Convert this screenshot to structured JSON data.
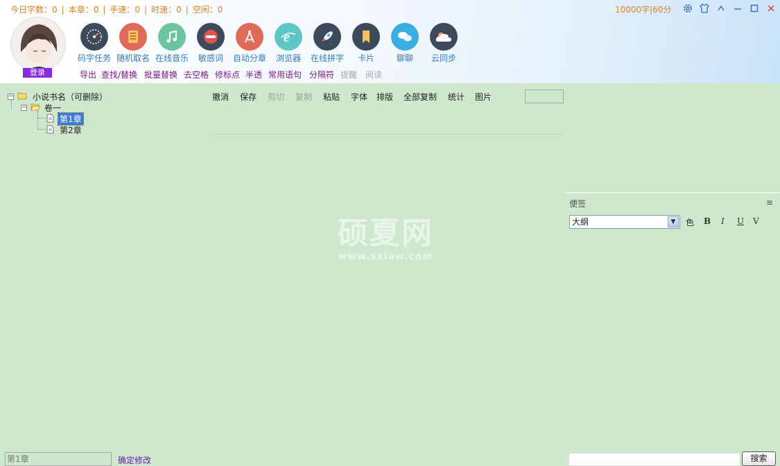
{
  "header": {
    "stats": [
      {
        "label": "今日字数：0"
      },
      {
        "label": "本章：0"
      },
      {
        "label": "手速：0"
      },
      {
        "label": "时速：0"
      },
      {
        "label": "空闲：0"
      }
    ],
    "quota": "10000字|60分",
    "login_label": "登录"
  },
  "toolbar": {
    "tools": [
      {
        "label": "码字任务",
        "icon": "speedometer-icon",
        "color": "#3d4a5c"
      },
      {
        "label": "随机取名",
        "icon": "notebook-icon",
        "color": "#e06b5a"
      },
      {
        "label": "在线音乐",
        "icon": "music-note-icon",
        "color": "#6cc4a0"
      },
      {
        "label": "敏感词",
        "icon": "no-entry-icon",
        "color": "#3d4a5c"
      },
      {
        "label": "自动分章",
        "icon": "compass-icon",
        "color": "#e06b5a"
      },
      {
        "label": "浏览器",
        "icon": "browser-icon",
        "color": "#5fc6c6"
      },
      {
        "label": "在线拼字",
        "icon": "rocket-icon",
        "color": "#3d4a5c"
      },
      {
        "label": "卡片",
        "icon": "bookmark-icon",
        "color": "#3d4a5c"
      },
      {
        "label": "聊聊",
        "icon": "chat-icon",
        "color": "#3aaee0"
      },
      {
        "label": "云同步",
        "icon": "cloud-icon",
        "color": "#3d4a5c"
      }
    ],
    "sublinks": [
      {
        "label": "导出",
        "enabled": true
      },
      {
        "label": "查找/替换",
        "enabled": true
      },
      {
        "label": "批量替换",
        "enabled": true
      },
      {
        "label": "去空格",
        "enabled": true
      },
      {
        "label": "修标点",
        "enabled": true
      },
      {
        "label": "半透",
        "enabled": true
      },
      {
        "label": "常用语句",
        "enabled": true
      },
      {
        "label": "分隔符",
        "enabled": true
      },
      {
        "label": "提醒",
        "enabled": false
      },
      {
        "label": "阅读",
        "enabled": false
      }
    ]
  },
  "tree": {
    "book": "小说书名（可删除）",
    "volume": "卷一",
    "chapters": [
      "第1章",
      "第2章"
    ],
    "selected_chapter": "第1章"
  },
  "editor_toolbar": [
    {
      "label": "撤消",
      "enabled": true
    },
    {
      "label": "保存",
      "enabled": true
    },
    {
      "label": "剪切",
      "enabled": false
    },
    {
      "label": "复制",
      "enabled": false
    },
    {
      "label": "粘贴",
      "enabled": true
    },
    {
      "label": "字体",
      "enabled": true
    },
    {
      "label": "排版",
      "enabled": true
    },
    {
      "label": "全部复制",
      "enabled": true
    },
    {
      "label": "统计",
      "enabled": true
    },
    {
      "label": "图片",
      "enabled": true
    }
  ],
  "watermark": {
    "big": "硕夏网",
    "small": "www.sxiaw.com"
  },
  "notes": {
    "title": "便签",
    "menu": "≡",
    "select_value": "大纲",
    "format_buttons": [
      "色",
      "B",
      "I",
      "U",
      "V"
    ]
  },
  "footer": {
    "chapter_value": "第1章",
    "confirm": "确定修改",
    "search_button": "搜索"
  },
  "colors": {
    "background": "#cde8cd",
    "stats": "#d9822b",
    "link": "#7a1a8c",
    "accent": "#8a2be2"
  }
}
